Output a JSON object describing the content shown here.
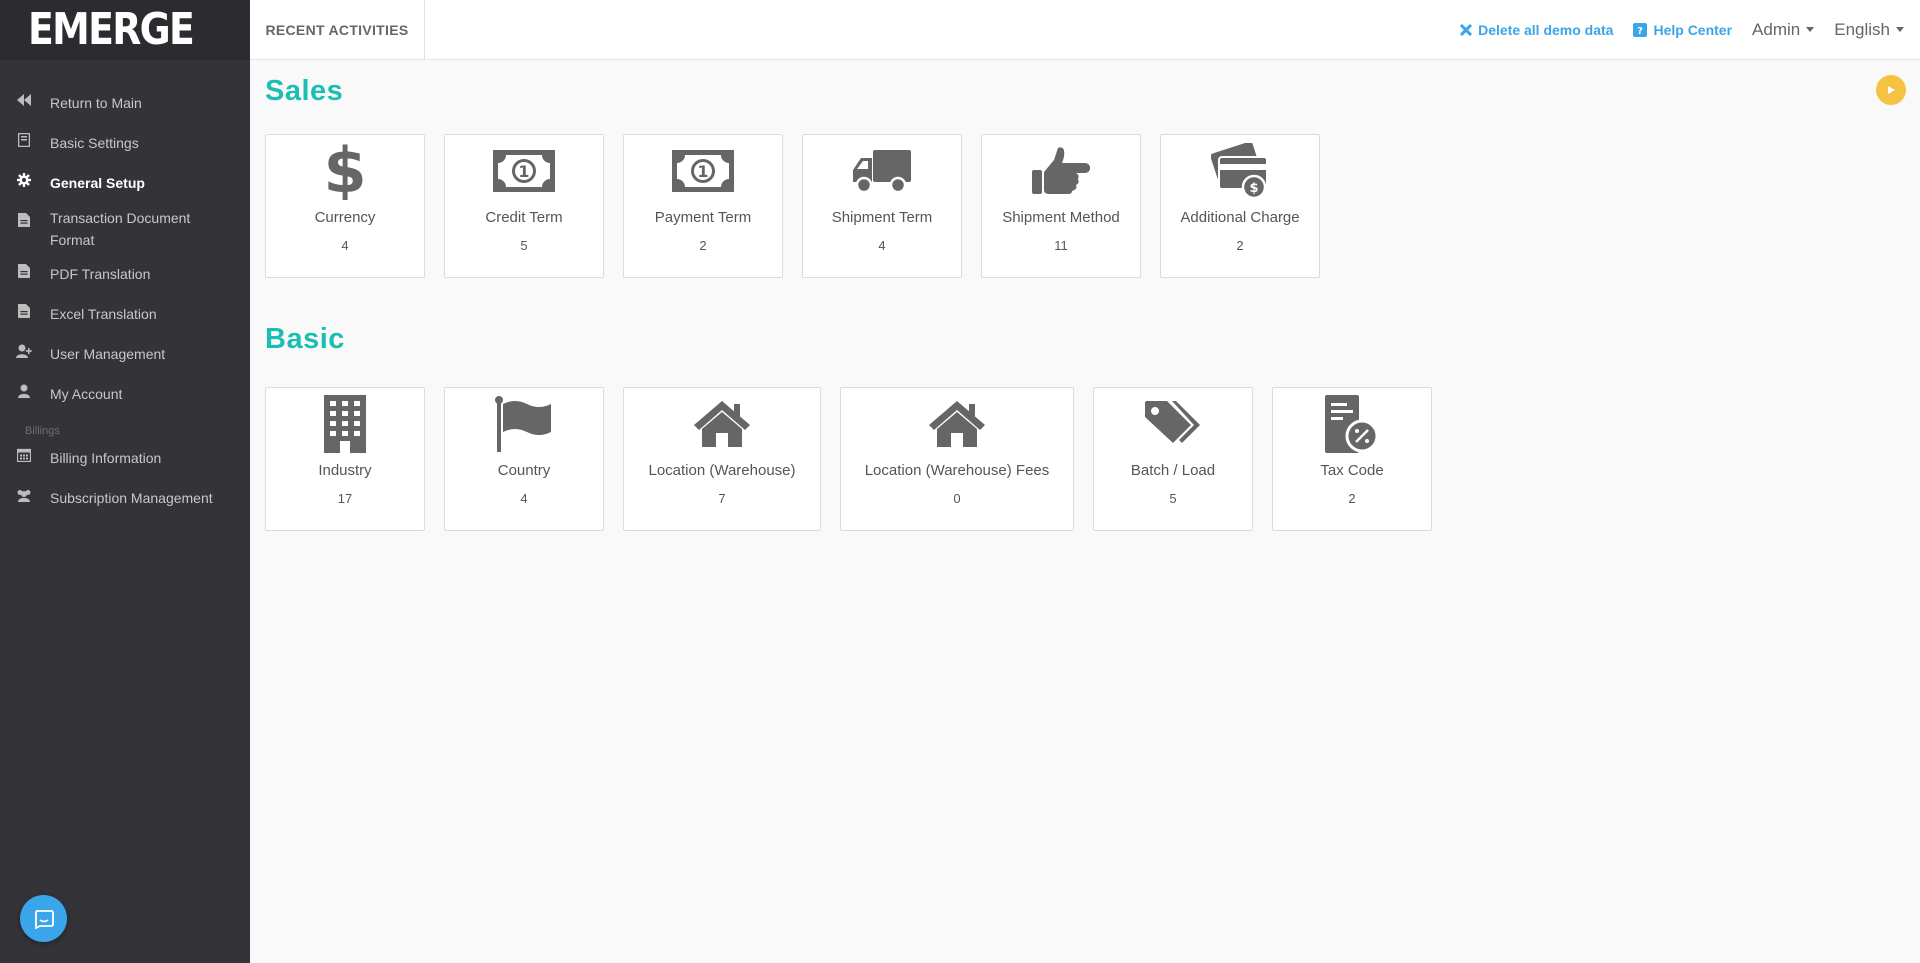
{
  "app": {
    "logo": "EMERGE",
    "brand_color": "#1bbfb2",
    "link_color": "#3aa5e8"
  },
  "sidebar": {
    "items": [
      {
        "label": "Return to Main",
        "icon": "fast-backward-icon"
      },
      {
        "label": "Basic Settings",
        "icon": "book-icon"
      },
      {
        "label": "General Setup",
        "icon": "gear-icon",
        "active": true
      },
      {
        "label": "Transaction Document Format",
        "icon": "document-icon"
      },
      {
        "label": "PDF Translation",
        "icon": "document-icon"
      },
      {
        "label": "Excel Translation",
        "icon": "document-icon"
      },
      {
        "label": "User Management",
        "icon": "user-plus-icon"
      },
      {
        "label": "My Account",
        "icon": "user-icon"
      }
    ],
    "billing_section_label": "Billings",
    "billing_items": [
      {
        "label": "Billing Information",
        "icon": "calendar-icon"
      },
      {
        "label": "Subscription Management",
        "icon": "users-icon"
      }
    ]
  },
  "topbar": {
    "recent_activities": "RECENT ACTIVITIES",
    "delete_demo": "Delete all demo data",
    "help_center": "Help Center",
    "admin": "Admin",
    "language": "English"
  },
  "sales": {
    "title": "Sales",
    "cards": [
      {
        "label": "Currency",
        "count": "4",
        "icon": "dollar-icon"
      },
      {
        "label": "Credit Term",
        "count": "5",
        "icon": "money-bill-icon"
      },
      {
        "label": "Payment Term",
        "count": "2",
        "icon": "money-bill-icon"
      },
      {
        "label": "Shipment Term",
        "count": "4",
        "icon": "truck-icon"
      },
      {
        "label": "Shipment Method",
        "count": "11",
        "icon": "hand-pointing-icon"
      },
      {
        "label": "Additional Charge",
        "count": "2",
        "icon": "credit-card-dollar-icon"
      }
    ]
  },
  "basic": {
    "title": "Basic",
    "cards": [
      {
        "label": "Industry",
        "count": "17",
        "icon": "building-icon"
      },
      {
        "label": "Country",
        "count": "4",
        "icon": "flag-icon"
      },
      {
        "label": "Location (Warehouse)",
        "count": "7",
        "icon": "house-icon"
      },
      {
        "label": "Location (Warehouse) Fees",
        "count": "0",
        "icon": "house-icon"
      },
      {
        "label": "Batch / Load",
        "count": "5",
        "icon": "tags-icon"
      },
      {
        "label": "Tax Code",
        "count": "2",
        "icon": "tax-document-icon"
      }
    ]
  }
}
